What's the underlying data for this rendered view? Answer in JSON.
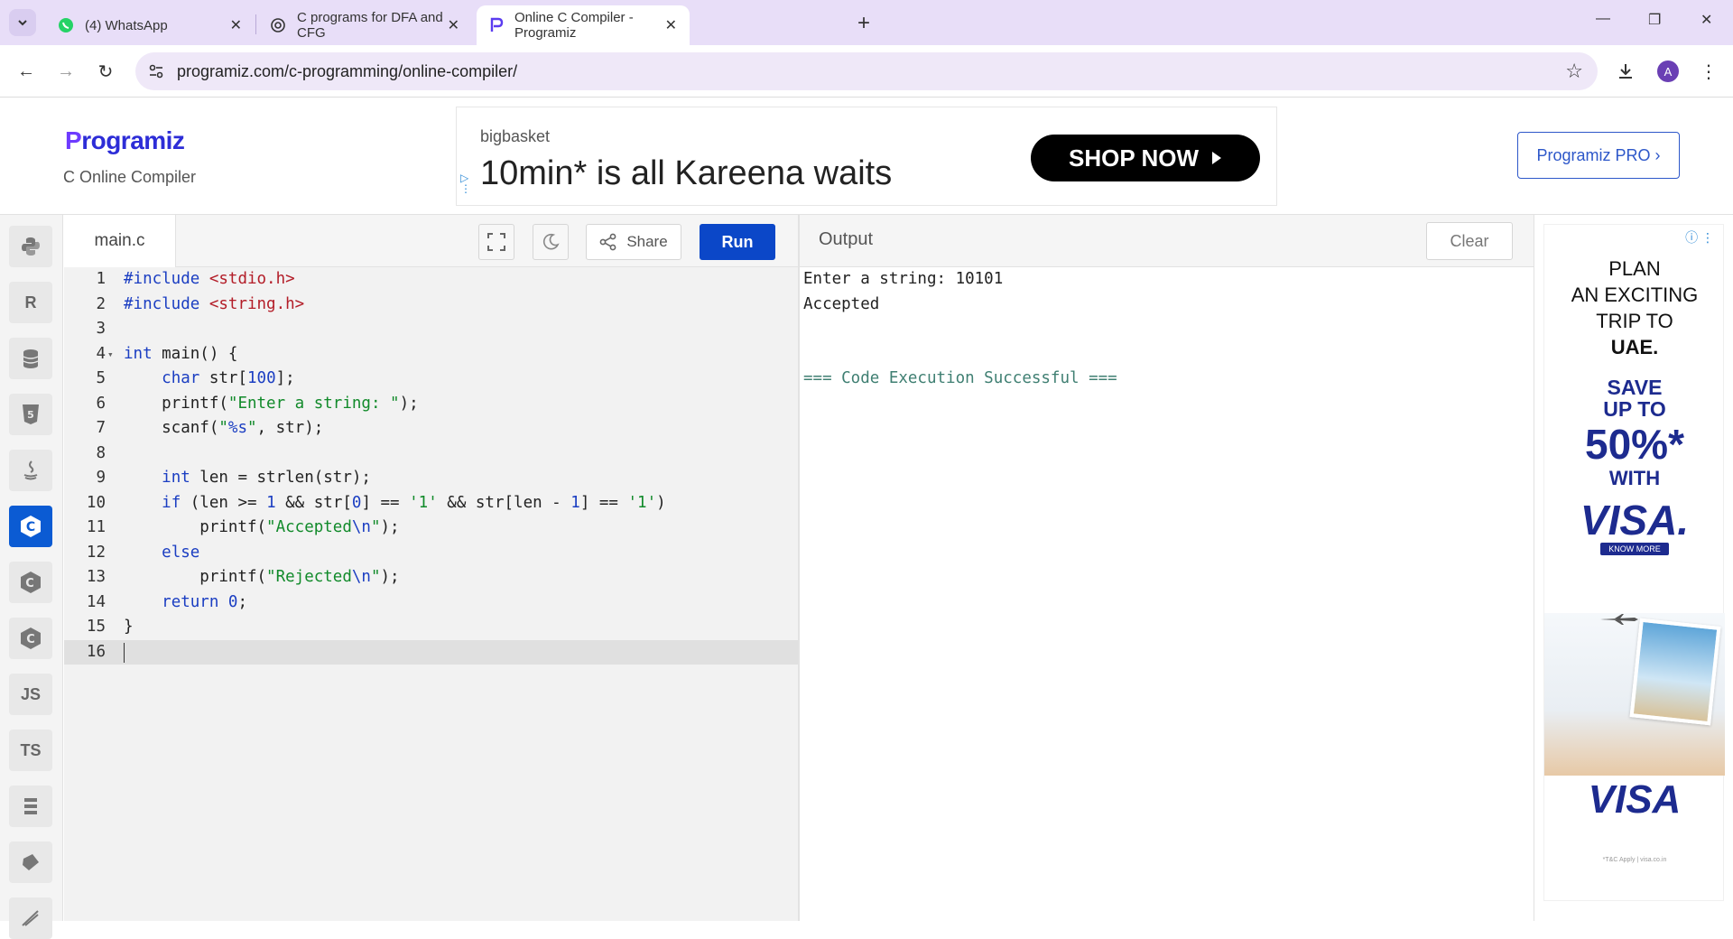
{
  "browser": {
    "tabs": [
      {
        "title": "(4) WhatsApp",
        "icon": "whatsapp-icon"
      },
      {
        "title": "C programs for DFA and CFG",
        "icon": "openai-icon"
      },
      {
        "title": "Online C Compiler - Programiz",
        "icon": "programiz-icon"
      }
    ],
    "url": "programiz.com/c-programming/online-compiler/",
    "profile_initial": "A"
  },
  "site": {
    "logo": "rogramiz",
    "logo_mark": "P",
    "subtitle": "C Online Compiler",
    "pro_button": "Programiz PRO ›"
  },
  "ad": {
    "brand": "bigbasket",
    "headline": "10min* is all Kareena waits",
    "cta": "SHOP NOW"
  },
  "rail": {
    "items": [
      "python",
      "r",
      "sql",
      "html",
      "java",
      "c",
      "cpp",
      "csharp",
      "JS",
      "TS",
      "swift",
      "go",
      "php"
    ],
    "active": "c"
  },
  "editor": {
    "filename": "main.c",
    "share_label": "Share",
    "run_label": "Run",
    "line_numbers": [
      "1",
      "2",
      "3",
      "4",
      "5",
      "6",
      "7",
      "8",
      "9",
      "10",
      "11",
      "12",
      "13",
      "14",
      "15",
      "16"
    ]
  },
  "output": {
    "title": "Output",
    "clear_label": "Clear",
    "lines": [
      "Enter a string: 10101",
      "Accepted",
      "",
      "",
      "=== Code Execution Successful ==="
    ]
  },
  "side_ad": {
    "line1": "PLAN",
    "line2": "AN EXCITING",
    "line3": "TRIP TO",
    "line4": "UAE.",
    "save1": "SAVE",
    "save2": "UP TO",
    "percent": "50%*",
    "with": "WITH",
    "visa": "VISA.",
    "know_more": "KNOW MORE",
    "brand": "VISA",
    "fine_print": "*T&C Apply | visa.co.in"
  },
  "colors": {
    "accent": "#0b47c8",
    "tabstrip": "#e8def8",
    "rail_active": "#0b5bd3"
  }
}
